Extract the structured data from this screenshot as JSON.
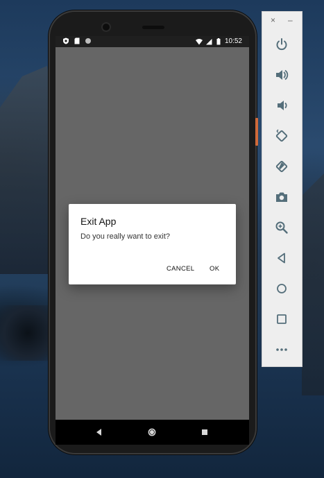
{
  "status_bar": {
    "time": "10:52"
  },
  "dialog": {
    "title": "Exit App",
    "message": "Do you really want to exit?",
    "cancel_label": "CANCEL",
    "ok_label": "OK"
  },
  "toolbar": {
    "close_label": "×",
    "minimize_label": "–",
    "buttons": [
      "power-icon",
      "volume-up-icon",
      "volume-down-icon",
      "rotate-left-icon",
      "rotate-right-icon",
      "camera-icon",
      "zoom-icon",
      "back-icon",
      "home-icon",
      "overview-icon",
      "more-icon"
    ]
  },
  "colors": {
    "app_background": "#666666",
    "dialog_background": "#ffffff",
    "toolbar_icon": "#546e7a",
    "side_button": "#d06a3a"
  }
}
